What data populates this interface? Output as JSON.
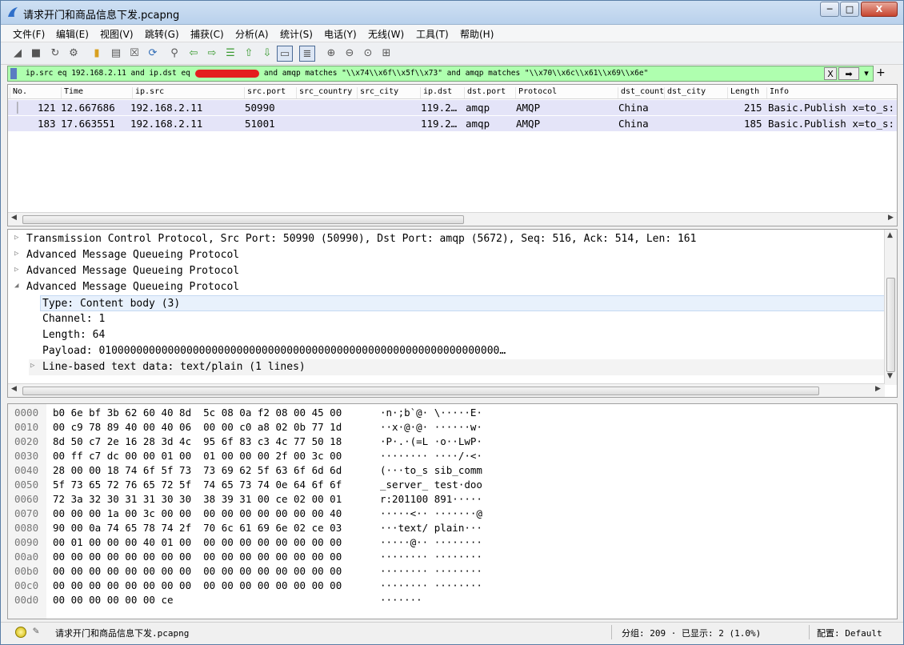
{
  "window": {
    "title": "请求开门和商品信息下发.pcapng",
    "min": "─",
    "max": "□",
    "close": "X"
  },
  "menu": [
    "文件(F)",
    "编辑(E)",
    "视图(V)",
    "跳转(G)",
    "捕获(C)",
    "分析(A)",
    "统计(S)",
    "电话(Y)",
    "无线(W)",
    "工具(T)",
    "帮助(H)"
  ],
  "filter": {
    "before_redact": "ip.src eq 192.168.2.11 and ip.dst eq",
    "after_redact": "and amqp matches \"\\\\x74\\\\x6f\\\\x5f\\\\x73\" and amqp matches \"\\\\x70\\\\x6c\\\\x61\\\\x69\\\\x6e\"",
    "clear_label": "X",
    "apply_label": "➡",
    "dropdown_label": "▾",
    "plus": "+"
  },
  "columns": [
    "No.",
    "Time",
    "ip.src",
    "src.port",
    "src_country",
    "src_city",
    "ip.dst",
    "dst.port",
    "Protocol",
    "dst_count",
    "dst_city",
    "Length",
    "Info"
  ],
  "packets": [
    {
      "no": "121",
      "time": "12.667686",
      "src": "192.168.2.11",
      "sport": "50990",
      "dst": "119.2…",
      "dport": "amqp",
      "proto": "AMQP",
      "country": "China",
      "len": "215",
      "info": "Basic.Publish x=to_s:"
    },
    {
      "no": "183",
      "time": "17.663551",
      "src": "192.168.2.11",
      "sport": "51001",
      "dst": "119.2…",
      "dport": "amqp",
      "proto": "AMQP",
      "country": "China",
      "len": "185",
      "info": "Basic.Publish x=to_s:"
    }
  ],
  "details": [
    {
      "tri": "▷",
      "text": "Transmission Control Protocol, Src Port: 50990 (50990), Dst Port: amqp (5672), Seq: 516, Ack: 514, Len: 161"
    },
    {
      "tri": "▷",
      "text": "Advanced Message Queueing Protocol"
    },
    {
      "tri": "▷",
      "text": "Advanced Message Queueing Protocol"
    },
    {
      "tri": "◢",
      "text": "Advanced Message Queueing Protocol"
    },
    {
      "tri": "",
      "text": "Type: Content body (3)"
    },
    {
      "tri": "",
      "text": "Channel: 1"
    },
    {
      "tri": "",
      "text": "Length: 64"
    },
    {
      "tri": "",
      "text": "Payload: 0100000000000000000000000000000000000000000000000000000000000000…"
    },
    {
      "tri": "▷",
      "text": "Line-based text data: text/plain (1 lines)"
    }
  ],
  "hex": [
    {
      "off": "0000",
      "hex": "b0 6e bf 3b 62 60 40 8d  5c 08 0a f2 08 00 45 00",
      "ascii": "·n·;b`@· \\·····E·"
    },
    {
      "off": "0010",
      "hex": "00 c9 78 89 40 00 40 06  00 00 c0 a8 02 0b 77 1d",
      "ascii": "··x·@·@· ······w·"
    },
    {
      "off": "0020",
      "hex": "8d 50 c7 2e 16 28 3d 4c  95 6f 83 c3 4c 77 50 18",
      "ascii": "·P·.·(=L ·o··LwP·"
    },
    {
      "off": "0030",
      "hex": "00 ff c7 dc 00 00 01 00  01 00 00 00 2f 00 3c 00",
      "ascii": "········ ····/·<·"
    },
    {
      "off": "0040",
      "hex": "28 00 00 18 74 6f 5f 73  73 69 62 5f 63 6f 6d 6d",
      "ascii": "(···to_s sib_comm"
    },
    {
      "off": "0050",
      "hex": "5f 73 65 72 76 65 72 5f  74 65 73 74 0e 64 6f 6f",
      "ascii": "_server_ test·doo"
    },
    {
      "off": "0060",
      "hex": "72 3a 32 30 31 31 30 30  38 39 31 00 ce 02 00 01",
      "ascii": "r:201100 891·····"
    },
    {
      "off": "0070",
      "hex": "00 00 00 1a 00 3c 00 00  00 00 00 00 00 00 00 40",
      "ascii": "·····<·· ·······@"
    },
    {
      "off": "0080",
      "hex": "90 00 0a 74 65 78 74 2f  70 6c 61 69 6e 02 ce 03",
      "ascii": "···text/ plain···"
    },
    {
      "off": "0090",
      "hex": "00 01 00 00 00 40 01 00  00 00 00 00 00 00 00 00",
      "ascii": "·····@·· ········"
    },
    {
      "off": "00a0",
      "hex": "00 00 00 00 00 00 00 00  00 00 00 00 00 00 00 00",
      "ascii": "········ ········"
    },
    {
      "off": "00b0",
      "hex": "00 00 00 00 00 00 00 00  00 00 00 00 00 00 00 00",
      "ascii": "········ ········"
    },
    {
      "off": "00c0",
      "hex": "00 00 00 00 00 00 00 00  00 00 00 00 00 00 00 00",
      "ascii": "········ ········"
    },
    {
      "off": "00d0",
      "hex": "00 00 00 00 00 00 ce",
      "ascii": "·······"
    }
  ],
  "status": {
    "file": "请求开门和商品信息下发.pcapng",
    "packets": "分组: 209 · 已显示: 2 (1.0%)",
    "profile": "配置: Default"
  },
  "colors": {
    "filter_bg": "#afffaf",
    "row_bg": "#e4e4f8",
    "highlight": "#e8f1fc"
  }
}
